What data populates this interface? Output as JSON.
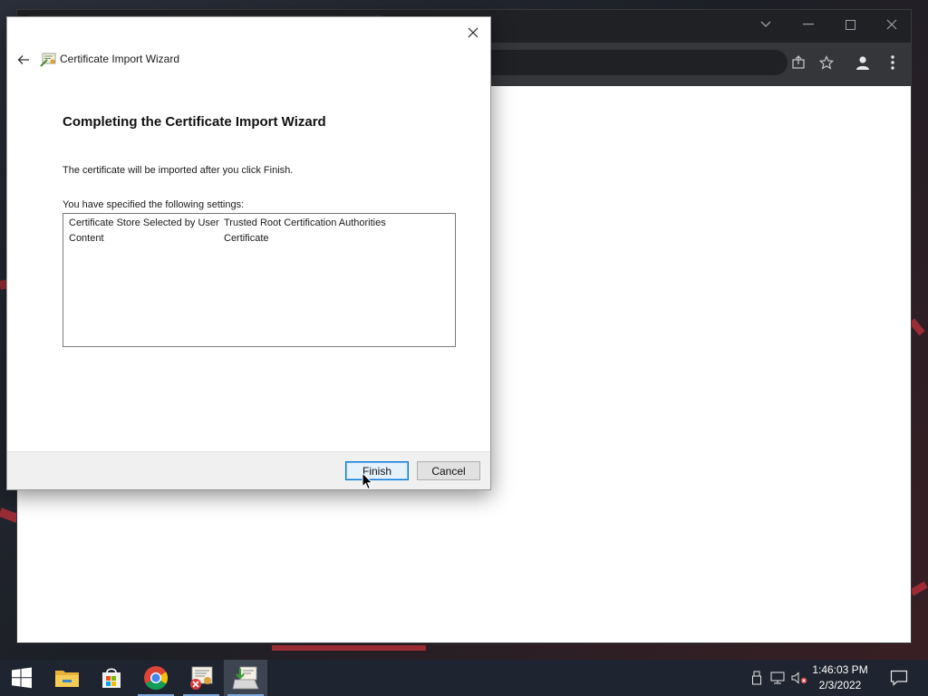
{
  "wizard": {
    "title": "Certificate Import Wizard",
    "heading": "Completing the Certificate Import Wizard",
    "description": "The certificate will be imported after you click Finish.",
    "settings_label": "You have specified the following settings:",
    "settings": [
      {
        "key": "Certificate Store Selected by User",
        "value": "Trusted Root Certification Authorities"
      },
      {
        "key": "Content",
        "value": "Certificate"
      }
    ],
    "finish_label": "Finish",
    "cancel_label": "Cancel"
  },
  "browser": {
    "icons": [
      "share-icon",
      "star-icon",
      "profile-icon",
      "menu-icon"
    ]
  },
  "taskbar": {
    "apps": [
      "start-icon",
      "file-explorer-icon",
      "store-icon",
      "chrome-icon",
      "certificate-manager-icon",
      "certificate-import-icon"
    ],
    "time": "1:46:03 PM",
    "date": "2/3/2022"
  },
  "colors": {
    "accent": "#0078d7",
    "taskbar": "#1f2530",
    "chrome_dark": "#202124"
  }
}
